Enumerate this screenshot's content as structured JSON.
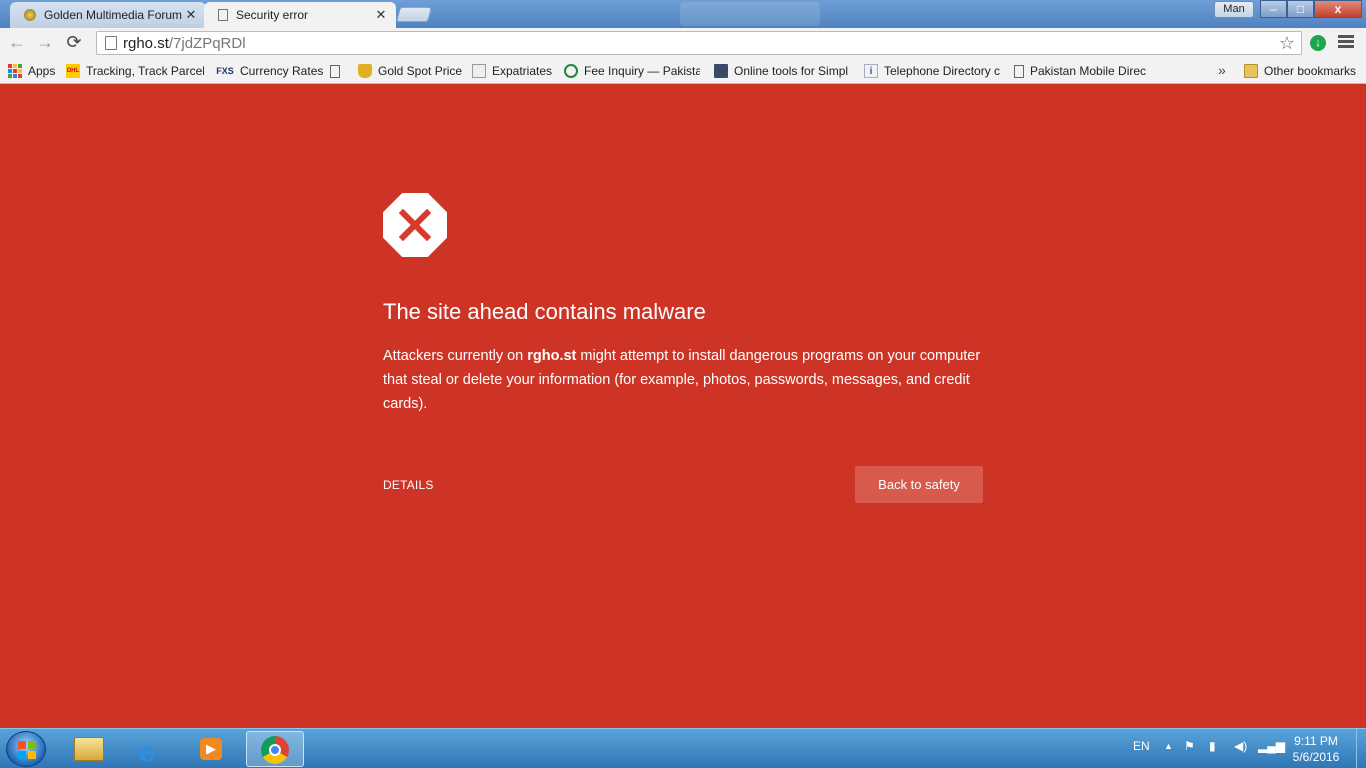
{
  "window": {
    "user_label": "Man",
    "controls": {
      "minimize": "–",
      "maximize": "□",
      "close": "x"
    }
  },
  "tabs": [
    {
      "title": "Golden Multimedia Forum",
      "active": false
    },
    {
      "title": "Security error",
      "active": true
    }
  ],
  "toolbar": {
    "back": "←",
    "forward": "→",
    "reload": "⟳",
    "url_host": "rgho.st",
    "url_path": "/7jdZPqRDl",
    "star": "☆",
    "download_icon": "↓"
  },
  "bookmarks": {
    "items": [
      {
        "label": "Apps",
        "icon": "apps-grid-icon"
      },
      {
        "label": "Tracking, Track Parcel",
        "icon": "dhl-icon"
      },
      {
        "label": "Currency Rates",
        "icon": "fxs-icon",
        "icon_text": "FXS"
      },
      {
        "label": "",
        "icon": "page-icon"
      },
      {
        "label": "Gold Spot Price",
        "icon": "gold-icon"
      },
      {
        "label": "Expatriates",
        "icon": "expatriates-icon"
      },
      {
        "label": "Fee Inquiry — Pakista",
        "icon": "fee-icon"
      },
      {
        "label": "Online tools for Simpl",
        "icon": "clapper-icon"
      },
      {
        "label": "Telephone Directory c",
        "icon": "info-icon",
        "icon_text": "i"
      },
      {
        "label": "Pakistan Mobile Direc",
        "icon": "page-icon"
      }
    ],
    "overflow": "»",
    "other": "Other bookmarks"
  },
  "interstitial": {
    "headline": "The site ahead contains malware",
    "body_prefix": "Attackers currently on ",
    "body_site": "rgho.st",
    "body_suffix": " might attempt to install dangerous programs on your computer that steal or delete your information (for example, photos, passwords, messages, and credit cards).",
    "details_label": "DETAILS",
    "back_button": "Back to safety",
    "accent": "#ce3426"
  },
  "taskbar": {
    "language": "EN",
    "time": "9:11 PM",
    "date": "5/6/2016",
    "apps": [
      "explorer-icon",
      "internet-explorer-icon",
      "media-player-icon",
      "chrome-icon"
    ]
  }
}
